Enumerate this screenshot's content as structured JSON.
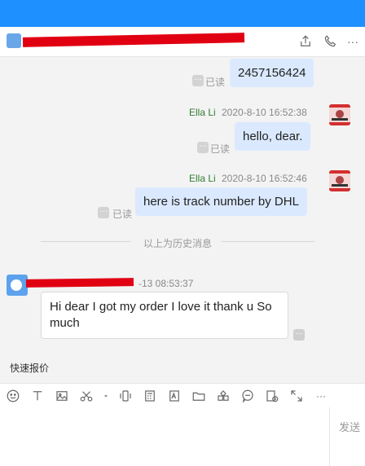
{
  "header": {},
  "messages": [
    {
      "text": "2457156424",
      "status": "已读"
    },
    {
      "sender": "Ella Li",
      "time": "2020-8-10 16:52:38",
      "text": "hello, dear.",
      "status": "已读"
    },
    {
      "sender": "Ella Li",
      "time": "2020-8-10 16:52:46",
      "text": "here is track number by DHL",
      "status": "已读"
    }
  ],
  "divider": {
    "text": "以上为历史消息"
  },
  "incoming": {
    "time_suffix": "-13 08:53:37",
    "text": "Hi dear I got my order I love it thank u So much"
  },
  "quick_reply": {
    "label": "快速报价"
  },
  "compose": {
    "send_label": "发送"
  },
  "icons": {
    "read_dots": "···",
    "more": "···"
  }
}
